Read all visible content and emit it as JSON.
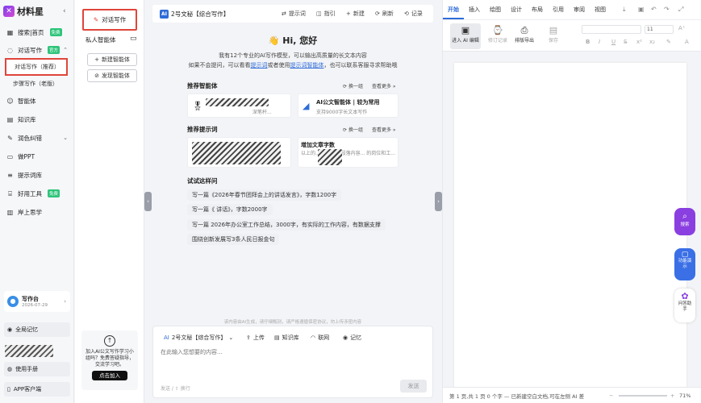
{
  "sidebar": {
    "logo_text": "材料星",
    "collapse_icon": "chevron-left-icon",
    "nav": [
      {
        "label": "搜索|首页",
        "tag": "免费",
        "icon": "grid-icon"
      },
      {
        "label": "对话写作",
        "tag": "官方",
        "icon": "chat-icon"
      },
      {
        "label": "智能体",
        "tag": "",
        "icon": "robot-icon"
      },
      {
        "label": "知识库",
        "tag": "",
        "icon": "book-icon"
      },
      {
        "label": "润色纠错",
        "tag": "",
        "icon": "edit-icon"
      },
      {
        "label": "做PPT",
        "tag": "",
        "icon": "slides-icon"
      },
      {
        "label": "提示词库",
        "tag": "",
        "icon": "lines-icon"
      },
      {
        "label": "好用工具",
        "tag": "免费",
        "icon": "toolbox-icon"
      },
      {
        "label": "岸上思学",
        "tag": "",
        "icon": "study-icon"
      }
    ],
    "sub_items": [
      "对话写作（推荐）",
      "步骤写作（老版）"
    ],
    "user_card": {
      "name": "写作台",
      "date": "2026-07-29"
    },
    "bottom": [
      {
        "label": "全局记忆"
      },
      {
        "label": "使用手册"
      },
      {
        "label": "APP客户端"
      }
    ]
  },
  "panel": {
    "chat_button": "对话写作",
    "section_title": "私人智能体",
    "new_agent": "新建智能体",
    "discover_agent": "发现智能体",
    "promo": {
      "text": "加入AI公文写作学习小组吗？免费答疑指导，交流学习吧。",
      "button": "点击加入"
    }
  },
  "main": {
    "header": {
      "title": "2号文秘【综合写作】",
      "actions": [
        "提示词",
        "指引",
        "新建",
        "刷新",
        "记录"
      ]
    },
    "welcome": {
      "greeting": "Hi, 您好",
      "line1": "我有12个专业的AI写作模型，可以输出高质量的长文本内容",
      "line2_pre": "如果不会提问，可以看看",
      "link1": "提示词",
      "line2_mid": "或者使用",
      "link2": "提示词智能体",
      "line2_post": "，也可以联系客服寻求帮助哦"
    },
    "recommended_agents": {
      "title": "推荐智能体",
      "refresh": "换一组",
      "more": "查看更多 »",
      "cards": [
        {
          "title": "",
          "sub": "深笔杆..."
        },
        {
          "title": "AI公文智能体 | 较为常用",
          "sub": "支持9000字长文本写作"
        }
      ]
    },
    "recommended_prompts": {
      "title": "推荐提示词",
      "refresh": "换一组",
      "more": "查看更多 »",
      "cards": [
        {
          "title": "",
          "sub": ""
        },
        {
          "title": "增加文章字数",
          "sub": "以上的... 查看各个段落内容... 的岗位和工..."
        }
      ]
    },
    "try_title": "试试这样问",
    "try_items": [
      "写一篇《2026年春节团拜会上的讲话发言》，字数1200字",
      "写一篇《                                讲话》，字数2000字",
      "写一篇 2026年办公室工作总结，3000字，有实际的工作内容，有数据支撑",
      "围绕创新发展写3条人民日报金句"
    ],
    "notice": "该内容由AI生成，请仔细甄别，请严格遵循保密协议，勿上传涉密内容",
    "composer": {
      "model": "2号文秘【综合写作】",
      "buttons": [
        "上传",
        "知识库",
        "联网",
        "记忆"
      ],
      "placeholder": "在此输入您想要的内容...",
      "hint": "发送 / ⇧ 换行",
      "send": "发送"
    }
  },
  "editor": {
    "tabs": [
      "开始",
      "插入",
      "绘图",
      "设计",
      "布局",
      "引用",
      "审阅",
      "视图"
    ],
    "ribbon": [
      {
        "label": "进入 AI 编辑",
        "icon": "ai-edit-icon"
      },
      {
        "label": "修订记录",
        "icon": "history-icon"
      },
      {
        "label": "排版导出",
        "icon": "export-icon"
      },
      {
        "label": "保存",
        "icon": "save-icon"
      }
    ],
    "font_size": "11",
    "status": "第 1 页,共 1 页   0 个字   — 已新建空白文档,可在左侧 AI 差",
    "zoom": "71%"
  },
  "float": [
    {
      "label": "搜索",
      "color": "#8a3fe0"
    },
    {
      "label": "功能演示",
      "color": "#3a6fe6"
    },
    {
      "label": "问答助手",
      "color": "#ffffff"
    }
  ]
}
